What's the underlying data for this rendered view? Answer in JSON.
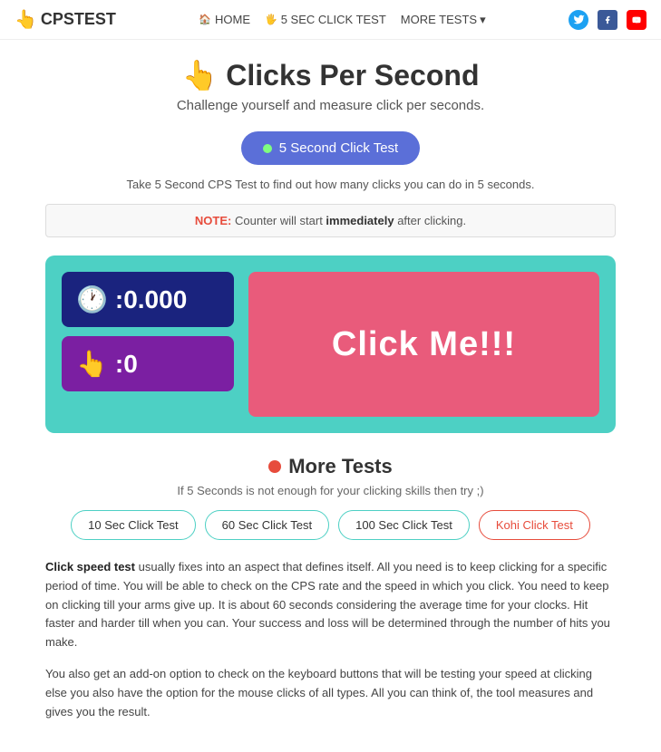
{
  "header": {
    "logo_icon": "👆",
    "logo_text": "CPSTEST",
    "nav": {
      "home_icon": "🏠",
      "home_label": "HOME",
      "click_test_icon": "🖐",
      "click_test_label": "5 SEC CLICK TEST",
      "more_tests_label": "MORE TESTS",
      "more_tests_arrow": "▾"
    },
    "social": {
      "twitter_label": "t",
      "facebook_label": "f",
      "youtube_label": "▶"
    }
  },
  "hero": {
    "hand_icon": "👆",
    "title": "Clicks Per Second",
    "subtitle": "Challenge yourself and measure click per seconds."
  },
  "cta": {
    "dot_color": "#7fff7f",
    "button_label": "5 Second Click Test"
  },
  "description": "Take 5 Second CPS Test to find out how many clicks you can do in 5 seconds.",
  "note": {
    "label": "NOTE:",
    "text_before": " Counter will start ",
    "immediately": "immediately",
    "text_after": " after clicking."
  },
  "click_test": {
    "timer_icon": "🕐",
    "timer_value": ":0.000",
    "click_icon": "👆",
    "click_count": ":0",
    "click_me_label": "Click Me!!!"
  },
  "more_tests": {
    "title": "More Tests",
    "subtitle": "If 5 Seconds is not enough for your clicking skills then try ;)",
    "buttons": [
      {
        "label": "10 Sec Click Test",
        "style": "normal"
      },
      {
        "label": "60 Sec Click Test",
        "style": "normal"
      },
      {
        "label": "100 Sec Click Test",
        "style": "normal"
      },
      {
        "label": "Kohi Click Test",
        "style": "red"
      }
    ]
  },
  "content": {
    "paragraph1_highlight": "Click speed test",
    "paragraph1_rest": " usually fixes into an aspect that defines itself. All you need is to keep clicking for a specific period of time. You will be able to check on the CPS rate and the speed in which you click. You need to keep on clicking till your arms give up. It is about 60 seconds considering the average time for your clocks. Hit faster and harder till when you can. Your success and loss will be determined through the number of hits you make.",
    "paragraph2": "You also get an add-on option to check on the keyboard buttons that will be testing your speed at clicking else you also have the option for the mouse clicks of all types. All you can think of, the tool measures and gives you the result."
  }
}
